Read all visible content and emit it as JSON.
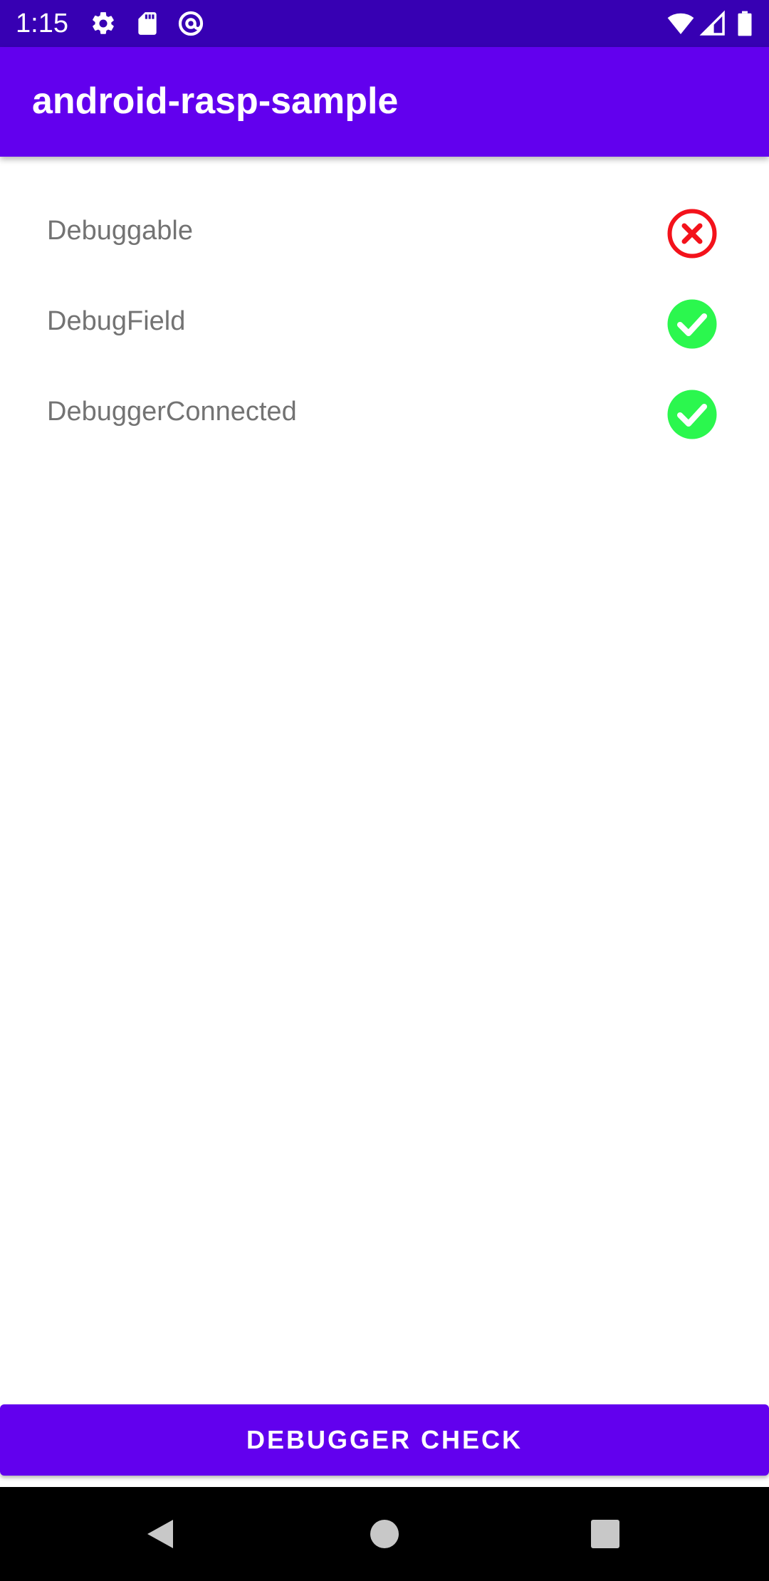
{
  "status_bar": {
    "time": "1:15",
    "left_icons": [
      "gear-icon",
      "sd-card-icon",
      "at-sign-icon"
    ],
    "right_icons": [
      "wifi-icon",
      "signal-icon",
      "battery-icon"
    ]
  },
  "app_bar": {
    "title": "android-rasp-sample"
  },
  "checks": [
    {
      "label": "Debuggable",
      "status": "fail",
      "icon": "error-circle-icon",
      "color": "#f3121b"
    },
    {
      "label": "DebugField",
      "status": "pass",
      "icon": "check-circle-icon",
      "color": "#2bf74e"
    },
    {
      "label": "DebuggerConnected",
      "status": "pass",
      "icon": "check-circle-icon",
      "color": "#2bf74e"
    }
  ],
  "action_button": {
    "label": "DEBUGGER CHECK"
  },
  "nav_bar": {
    "buttons": [
      "back-icon",
      "home-icon",
      "recents-icon"
    ]
  },
  "colors": {
    "status_bar": "#3700b3",
    "primary": "#6200ee",
    "label_text": "#737373",
    "pass": "#2bf74e",
    "fail": "#f3121b"
  }
}
